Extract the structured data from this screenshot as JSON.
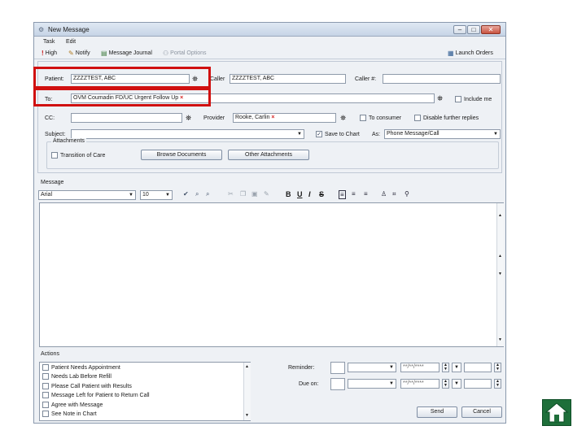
{
  "window": {
    "title": "New Message",
    "controls": [
      "–",
      "□",
      "✕"
    ]
  },
  "menu": [
    {
      "label": "Task"
    },
    {
      "label": "Edit"
    }
  ],
  "toolbar": {
    "high": "High",
    "notify": "Notify",
    "message_journal": "Message Journal",
    "portal_options": "Portal Options",
    "launch_orders": "Launch Orders"
  },
  "form": {
    "patient_label": "Patient:",
    "patient_value": "ZZZZTEST, ABC",
    "caller_label": "Caller",
    "caller_value": "ZZZZTEST, ABC",
    "caller_num_label": "Caller #:",
    "caller_num_value": "",
    "to_label": "To:",
    "to_value": "OVM Coumadin FD/UC Urgent Follow Up",
    "include_me": "Include me",
    "cc_label": "CC:",
    "cc_value": "",
    "provider_label": "Provider",
    "provider_value": "Rooke, Carlin",
    "to_consumer": "To consumer",
    "disable_replies": "Disable further replies",
    "subject_label": "Subject:",
    "subject_value": "",
    "save_to_chart": "Save to Chart",
    "save_to_chart_checked": true,
    "as_label": "As:",
    "as_value": "Phone Message/Call",
    "attachments_label": "Attachments",
    "transition_of_care": "Transition of Care",
    "browse_documents": "Browse Documents",
    "other_attachments": "Other Attachments"
  },
  "message": {
    "label": "Message",
    "font": "Arial",
    "size": "10",
    "bold": "B",
    "underline": "U",
    "italic": "I",
    "strike": "S"
  },
  "actions": {
    "label": "Actions",
    "items": [
      {
        "label": "Patient Needs Appointment"
      },
      {
        "label": "Needs Lab Before Refill"
      },
      {
        "label": "Please Call Patient with Results"
      },
      {
        "label": "Message Left for Patient to Return Call"
      },
      {
        "label": "Agree with Message"
      },
      {
        "label": "See Note in Chart"
      }
    ],
    "reminder_label": "Reminder:",
    "due_on_label": "Due on:",
    "date_placeholder": "**/**/****",
    "send": "Send",
    "cancel": "Cancel"
  },
  "colors": {
    "highlight": "#d01010",
    "home": "#1e6f3a"
  }
}
